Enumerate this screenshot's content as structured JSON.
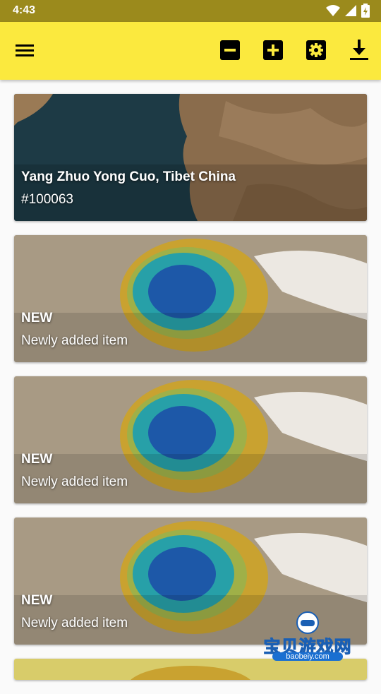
{
  "status_bar": {
    "time": "4:43",
    "icons": [
      "wifi-icon",
      "signal-icon",
      "battery-icon"
    ]
  },
  "toolbar": {
    "icons": [
      "menu-icon",
      "minus-box-icon",
      "plus-box-icon",
      "settings-box-icon",
      "download-icon"
    ],
    "background": "#fbe93e"
  },
  "cards": [
    {
      "title": "Yang Zhuo Yong Cuo, Tibet China",
      "subtitle": "#100063",
      "image": "lake-aerial"
    },
    {
      "title": "NEW",
      "subtitle": "Newly added item",
      "image": "hot-spring-aerial"
    },
    {
      "title": "NEW",
      "subtitle": "Newly added item",
      "image": "hot-spring-aerial"
    },
    {
      "title": "NEW",
      "subtitle": "Newly added item",
      "image": "hot-spring-aerial"
    }
  ],
  "watermark": {
    "text": "宝贝游戏网",
    "url": "baobeiy.com"
  }
}
